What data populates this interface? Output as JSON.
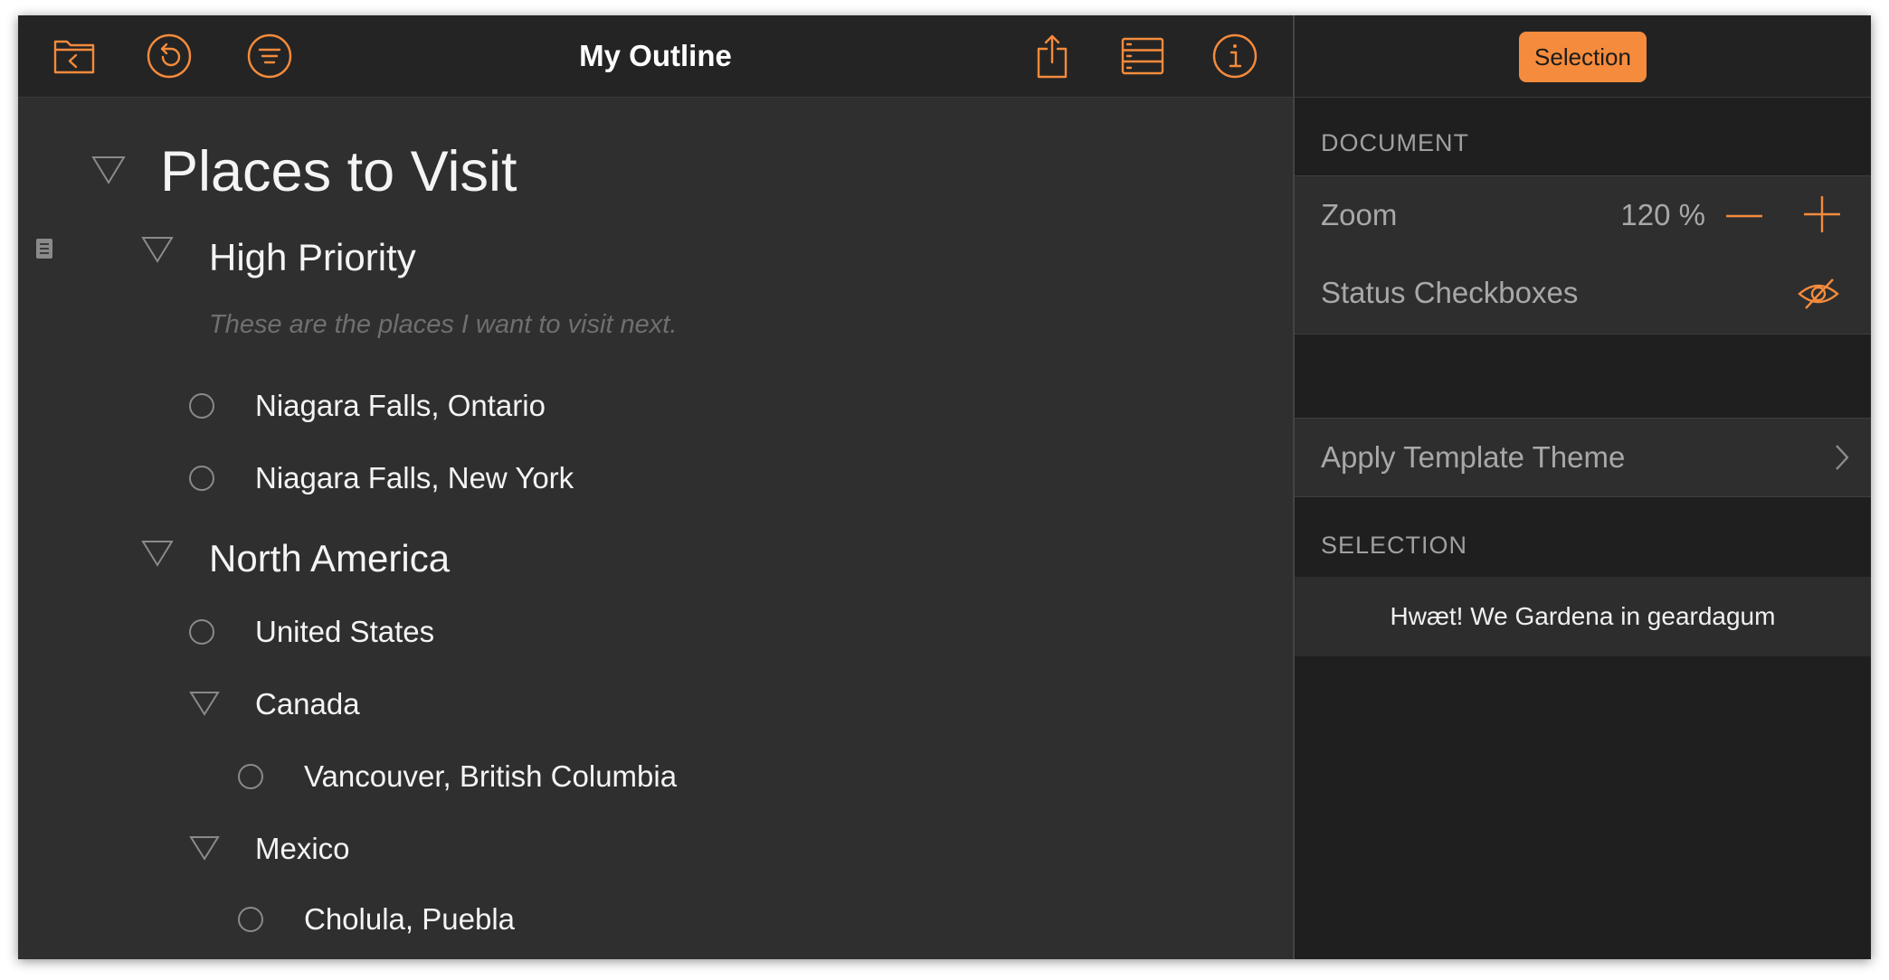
{
  "toolbar": {
    "title": "My Outline",
    "left_icons": [
      "folder-back-icon",
      "undo-icon",
      "filter-icon"
    ],
    "right_icons": [
      "share-icon",
      "rows-icon",
      "info-icon"
    ]
  },
  "outline": {
    "items": [
      {
        "label": "Places to Visit",
        "level": 0,
        "kind": "heading"
      },
      {
        "label": "High Priority",
        "level": 1,
        "kind": "heading",
        "note": "These are the places I want to visit next."
      },
      {
        "label": "Niagara Falls, Ontario",
        "level": 2,
        "kind": "status"
      },
      {
        "label": "Niagara Falls, New York",
        "level": 2,
        "kind": "status"
      },
      {
        "label": "North America",
        "level": 1,
        "kind": "heading"
      },
      {
        "label": "United States",
        "level": 2,
        "kind": "status"
      },
      {
        "label": "Canada",
        "level": 2,
        "kind": "heading"
      },
      {
        "label": "Vancouver, British Columbia",
        "level": 3,
        "kind": "status"
      },
      {
        "label": "Mexico",
        "level": 2,
        "kind": "heading"
      },
      {
        "label": "Cholula, Puebla",
        "level": 3,
        "kind": "status"
      }
    ]
  },
  "inspector": {
    "tab": "Selection",
    "document_label": "DOCUMENT",
    "zoom_label": "Zoom",
    "zoom_value": "120 %",
    "status_checkboxes_label": "Status Checkboxes",
    "template_label": "Apply Template Theme",
    "selection_label": "SELECTION",
    "selection_preview": "Hwæt! We Gardena in geardagum"
  },
  "colors": {
    "accent": "#f58b3c",
    "background": "#2f2f2f",
    "toolbar": "#242424",
    "inspector": "#1f1f1f"
  }
}
